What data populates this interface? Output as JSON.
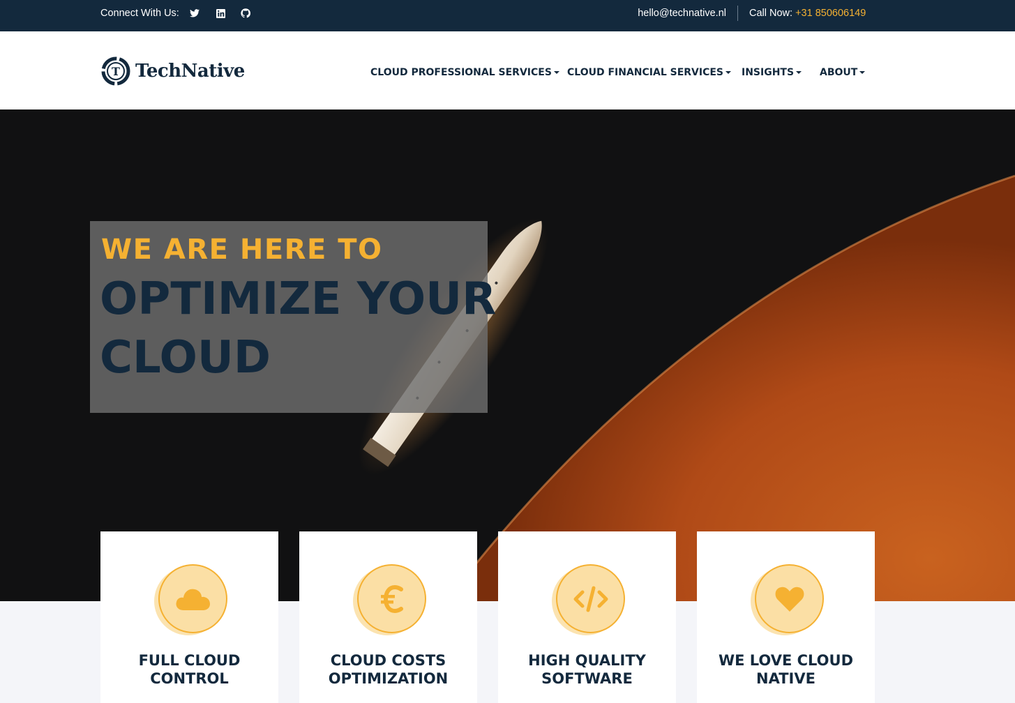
{
  "topbar": {
    "connect_label": "Connect With Us:",
    "social_icons": [
      "twitter-icon",
      "linkedin-icon",
      "github-icon"
    ],
    "email": "hello@technative.nl",
    "call_label": "Call Now: ",
    "phone": "+31 850606149"
  },
  "header": {
    "logo_letter": "T",
    "logo_text": "TechNative",
    "nav": [
      {
        "label": "CLOUD PROFESSIONAL SERVICES"
      },
      {
        "label": "CLOUD FINANCIAL SERVICES"
      },
      {
        "label": "INSIGHTS"
      },
      {
        "label": "ABOUT"
      }
    ]
  },
  "hero": {
    "kicker": "WE ARE HERE TO",
    "title_line1": "OPTIMIZE YOUR",
    "title_line2": "CLOUD"
  },
  "features": [
    {
      "icon": "cloud-icon",
      "title_line1": "FULL CLOUD",
      "title_line2": "CONTROL"
    },
    {
      "icon": "euro-icon",
      "title_line1": "CLOUD COSTS",
      "title_line2": "OPTIMIZATION"
    },
    {
      "icon": "code-icon",
      "title_line1": "HIGH QUALITY",
      "title_line2": "SOFTWARE"
    },
    {
      "icon": "heart-icon",
      "title_line1": "WE LOVE CLOUD",
      "title_line2": "NATIVE"
    }
  ],
  "colors": {
    "navy": "#13293d",
    "accent": "#f5b132",
    "icon_fill": "#fbdfa5",
    "planet": "#b8521e"
  }
}
